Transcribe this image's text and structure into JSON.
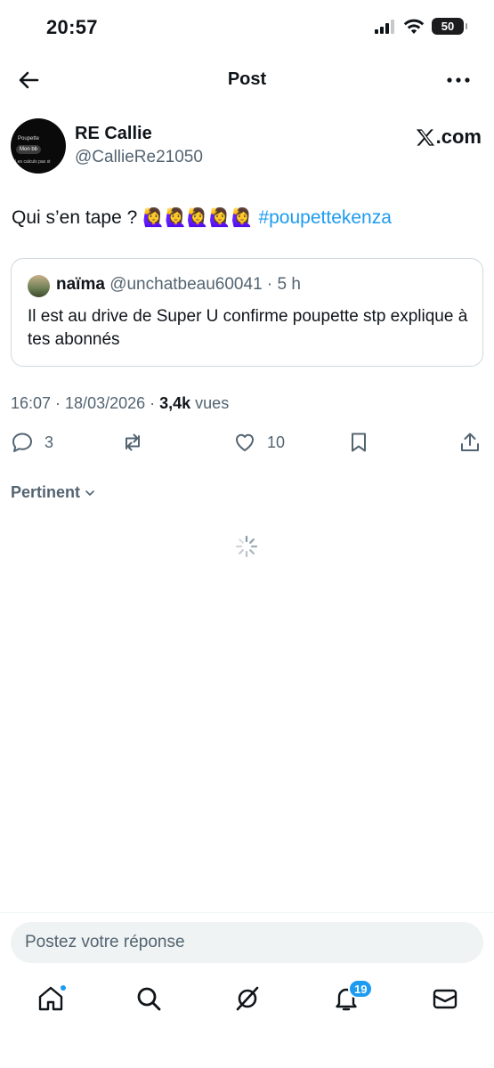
{
  "status_bar": {
    "time": "20:57",
    "battery": "50"
  },
  "nav": {
    "title": "Post"
  },
  "author": {
    "name": "RE Callie",
    "handle": "@CallieRe21050",
    "avatar_text": [
      "Poupette",
      "Mon bb",
      "Les calculs pas st"
    ],
    "brand": ".com"
  },
  "post": {
    "text": "Qui s’en tape ? ",
    "emojis": "🙋‍♀️🙋‍♀️🙋‍♀️🙋‍♀️🙋‍♀️",
    "hashtag": "#poupettekenza",
    "timestamp": "16:07 · 18/03/2026 · ",
    "views_count": "3,4k",
    "views_label": " vues"
  },
  "quote": {
    "name": "naïma",
    "meta": " @unchatbeau60041 · 5 h",
    "text": "Il est au drive de Super U confirme poupette stp explique à tes abonnés"
  },
  "actions": {
    "replies": "3",
    "likes": "10"
  },
  "sort_label": "Pertinent",
  "reply": {
    "placeholder": "Postez votre réponse"
  },
  "tabbar": {
    "notifications_badge": "19"
  },
  "colors": {
    "accent": "#1d9bf0",
    "secondary_text": "#536471",
    "border": "#cfd9de"
  }
}
